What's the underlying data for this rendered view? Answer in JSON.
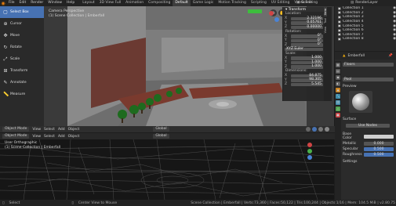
{
  "menubar": {
    "menus": [
      "File",
      "Edit",
      "Render",
      "Window",
      "Help"
    ],
    "workspaces": [
      "Layout",
      "3D View Full",
      "Animation",
      "Compositing",
      "Default",
      "Game Logic",
      "Motion Tracking",
      "Scripting",
      "UV Editing",
      "Video Editing"
    ],
    "active_workspace": "Default",
    "scene_label": "Scene",
    "render_layer_label": "RenderLayer"
  },
  "tools": [
    {
      "label": "Select Box",
      "icon": "▢"
    },
    {
      "label": "Cursor",
      "icon": "⊕"
    },
    {
      "label": "Move",
      "icon": "✥"
    },
    {
      "label": "Rotate",
      "icon": "↻"
    },
    {
      "label": "Scale",
      "icon": "⤢"
    },
    {
      "label": "Transform",
      "icon": "⊞"
    },
    {
      "label": "Annotate",
      "icon": "✎"
    },
    {
      "label": "Measure",
      "icon": "📏"
    }
  ],
  "viewport_top": {
    "perspective": "Camera Perspective",
    "collection": "(1) Scene Collection | Emberfall",
    "header": {
      "mode": "Object Mode",
      "view": "View",
      "select": "Select",
      "add": "Add",
      "object": "Object",
      "transform": "Global"
    }
  },
  "viewport_bottom": {
    "perspective": "User Orthographic",
    "collection": "(1) Scene Collection | Emberfall",
    "header": {
      "mode": "Object Mode",
      "view": "View",
      "select": "Select",
      "add": "Add",
      "object": "Object",
      "transform": "Global"
    }
  },
  "npanel": {
    "title": "Transform",
    "location_label": "Location:",
    "location": [
      {
        "axis": "X",
        "value": "2.32196"
      },
      {
        "axis": "Y",
        "value": "0.05761"
      },
      {
        "axis": "Z",
        "value": "0.00000"
      }
    ],
    "rotation_label": "Rotation:",
    "rotation": [
      {
        "axis": "X",
        "value": "0°"
      },
      {
        "axis": "Y",
        "value": "0°"
      },
      {
        "axis": "Z",
        "value": "0°"
      }
    ],
    "rotation_mode": "XYZ Euler",
    "scale_label": "Scale:",
    "scale": [
      {
        "axis": "X",
        "value": "1.000"
      },
      {
        "axis": "Y",
        "value": "1.000"
      },
      {
        "axis": "Z",
        "value": "1.000"
      }
    ],
    "dimensions_label": "Dimensions:",
    "dimensions": [
      {
        "axis": "X",
        "value": "84.875"
      },
      {
        "axis": "Y",
        "value": "98.305"
      },
      {
        "axis": "Z",
        "value": "5.545"
      }
    ],
    "tabs": [
      "Item",
      "Tool",
      "View"
    ]
  },
  "outliner": {
    "rows": [
      {
        "name": "Collection 1"
      },
      {
        "name": "Collection 2"
      },
      {
        "name": "Collection 3"
      },
      {
        "name": "Collection 4"
      },
      {
        "name": "Collection 5"
      },
      {
        "name": "Collection 6"
      },
      {
        "name": "Collection 7"
      },
      {
        "name": "Collection 8"
      }
    ]
  },
  "properties": {
    "object_name": "Emberfall",
    "slot": "Floors",
    "material": "Pool",
    "preview_label": "Preview",
    "surface_label": "Surface",
    "use_nodes": "Use Nodes",
    "base_color_label": "Base Color",
    "metallic_label": "Metallic",
    "metallic_value": "0.000",
    "specular_label": "Specular",
    "specular_value": "0.500",
    "roughness_label": "Roughness",
    "roughness_value": "0.500",
    "settings_label": "Settings"
  },
  "status": {
    "left": "Select",
    "middle": "Center View to Mouse",
    "right": "Scene Collection | Emberfall | Verts:73,360 | Faces:50,122 | Tris:100,244 | Objects:1/16 | Mem: 104.5 MiB | v2.80.75"
  },
  "colors": {
    "accent": "#4772b3",
    "brand": "#e87d0d",
    "grass": "#2d8a2d",
    "brick": "#7a3a2e"
  }
}
